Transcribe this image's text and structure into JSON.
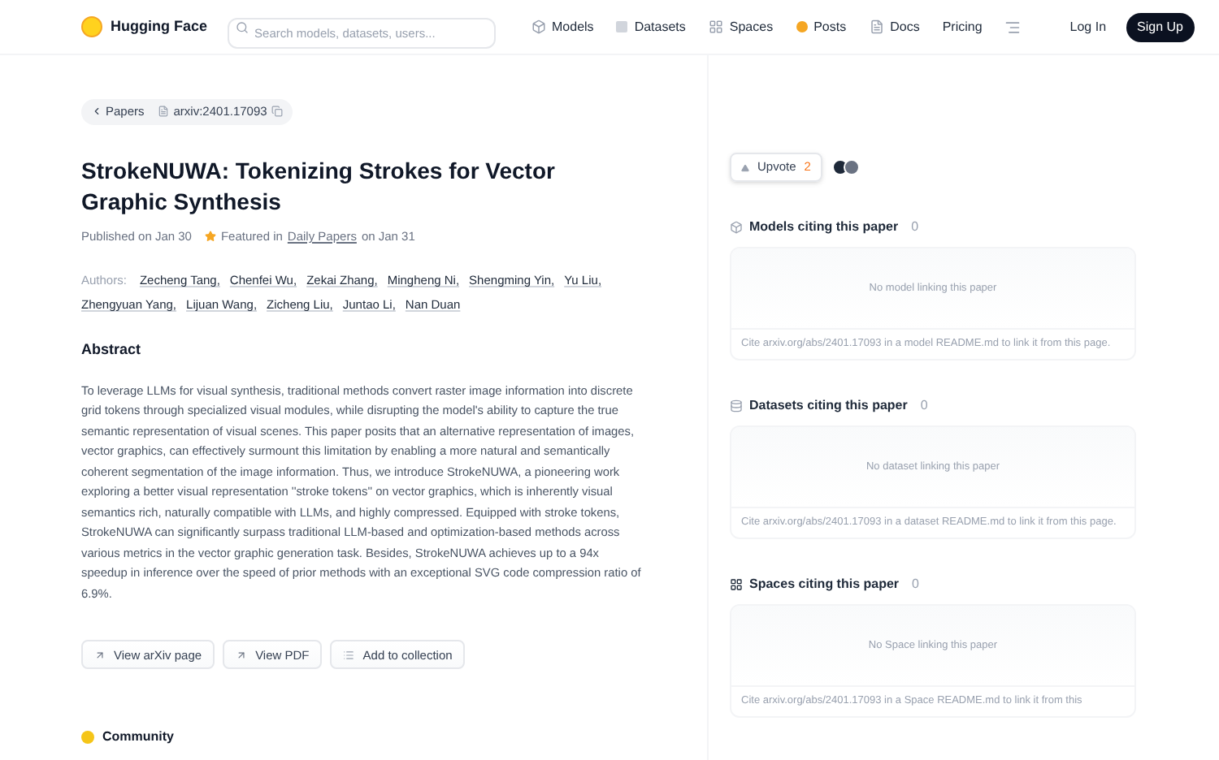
{
  "nav": {
    "brand": "Hugging Face",
    "search": {
      "placeholder": "Search models, datasets, users..."
    },
    "items": [
      {
        "label": "Models",
        "kind": "models"
      },
      {
        "label": "Datasets",
        "kind": "datasets"
      },
      {
        "label": "Spaces",
        "kind": "spaces"
      },
      {
        "label": "Posts",
        "kind": "posts"
      },
      {
        "label": "Docs",
        "kind": "docs"
      },
      {
        "label": "Pricing",
        "kind": "plain"
      }
    ],
    "login": "Log In",
    "signup": "Sign Up"
  },
  "breadcrumb": {
    "back": "Papers",
    "arxiv": "arxiv:2401.17093"
  },
  "paper": {
    "title": "StrokeNUWA: Tokenizing Strokes for Vector Graphic Synthesis",
    "published": "Published on Jan 30",
    "featured_prefix": "Featured in",
    "featured_link": "Daily Papers",
    "featured_suffix": "on Jan 31",
    "authors_label": "Authors:",
    "authors": [
      "Zecheng Tang,",
      "Chenfei Wu,",
      "Zekai Zhang,",
      "Mingheng Ni,",
      "Shengming Yin,",
      "Yu Liu,",
      "Zhengyuan Yang,",
      "Lijuan Wang,",
      "Zicheng Liu,",
      "Juntao Li,",
      "Nan Duan"
    ],
    "abstract_heading": "Abstract",
    "abstract": "To leverage LLMs for visual synthesis, traditional methods convert raster image information into discrete grid tokens through specialized visual modules, while disrupting the model's ability to capture the true semantic representation of visual scenes. This paper posits that an alternative representation of images, vector graphics, can effectively surmount this limitation by enabling a more natural and semantically coherent segmentation of the image information. Thus, we introduce StrokeNUWA, a pioneering work exploring a better visual representation ''stroke tokens'' on vector graphics, which is inherently visual semantics rich, naturally compatible with LLMs, and highly compressed. Equipped with stroke tokens, StrokeNUWA can significantly surpass traditional LLM-based and optimization-based methods across various metrics in the vector graphic generation task. Besides, StrokeNUWA achieves up to a 94x speedup in inference over the speed of prior methods with an exceptional SVG code compression ratio of 6.9%.",
    "actions": [
      {
        "label": "View arXiv page",
        "kind": "link"
      },
      {
        "label": "View PDF",
        "kind": "link"
      },
      {
        "label": "Add to collection",
        "kind": "collection"
      }
    ],
    "community": "Community"
  },
  "upvote": {
    "label": "Upvote",
    "count": "2"
  },
  "citing": [
    {
      "kind": "model",
      "heading": "Models citing this paper",
      "count": "0",
      "empty": "No model linking this paper",
      "cite": "Cite arxiv.org/abs/2401.17093 in a model README.md to link it from this page."
    },
    {
      "kind": "dataset",
      "heading": "Datasets citing this paper",
      "count": "0",
      "empty": "No dataset linking this paper",
      "cite": "Cite arxiv.org/abs/2401.17093 in a dataset README.md to link it from this page."
    },
    {
      "kind": "space",
      "heading": "Spaces citing this paper",
      "count": "0",
      "empty": "No Space linking this paper",
      "cite": "Cite arxiv.org/abs/2401.17093 in a Space README.md to link it from this"
    }
  ]
}
